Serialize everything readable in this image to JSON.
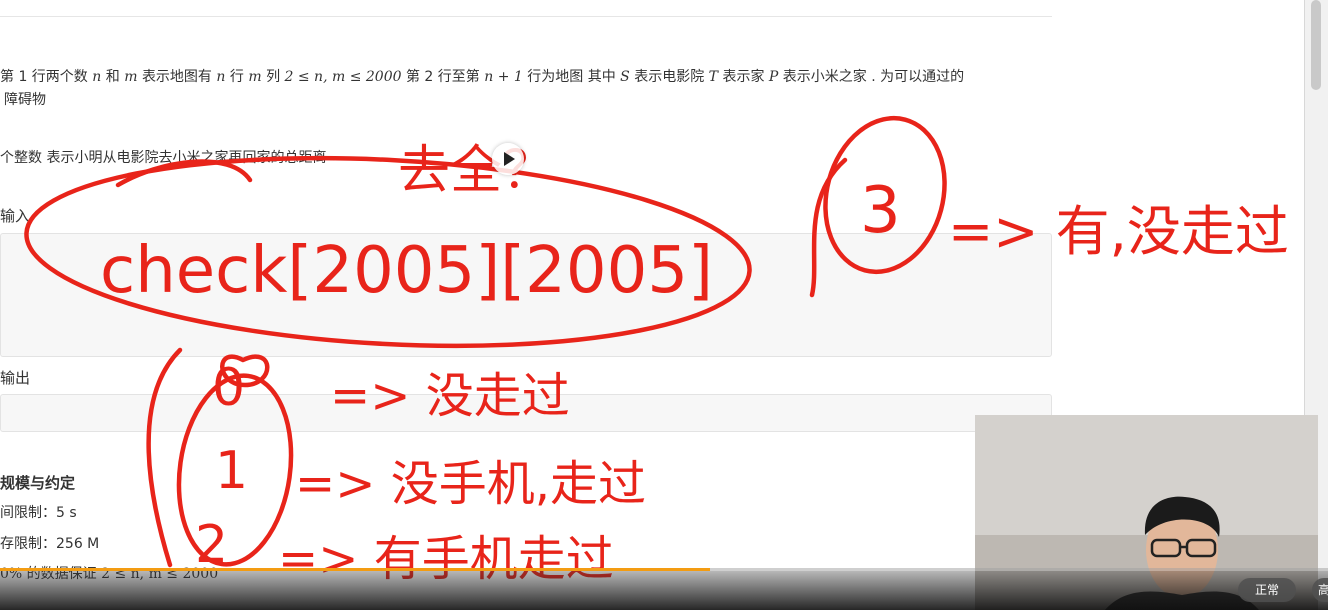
{
  "problem": {
    "input_line1_pre": "第 1 行两个数",
    "var_n": "n",
    "and": "和",
    "var_m": "m",
    "line1_b": "表示地图有",
    "line1_c": "行",
    "line1_d": "列",
    "constraint_math": "2 ≤ n, m ≤ 2000",
    "line1_e": "第 2 行至第",
    "n_plus_1": "n + 1",
    "line1_f": "行为地图 其中",
    "var_S": "S",
    "line1_g": "表示电影院",
    "var_T": "T",
    "line1_h": "表示家",
    "var_P": "P",
    "line1_i": "表示小米之家 . 为可以通过的",
    "input_line2": "障碍物",
    "output_desc": "个整数 表示小明从电影院去小米之家再回家的总距离",
    "sample_input_heading": "输入",
    "sample_output_heading": "输出",
    "limits_heading": "规模与约定",
    "time_limit": "间限制：5 s",
    "memory_limit": "存限制：256 M",
    "data_guarantee": "0% 的数据保证 2 ≤ n, m ≤ 2000"
  },
  "annotations": {
    "top_question": "去全？",
    "check_array": "check[2005][2005]",
    "state_3": "3",
    "state_3_desc": "=> 有,没走过",
    "state_0": "0",
    "state_0_desc": "=> 没走过",
    "state_1": "1",
    "state_1_desc": "=> 没手机,走过",
    "state_2": "2",
    "state_2_desc": "=> 有手机走过",
    "color": "#e8241a"
  },
  "player": {
    "progress_fraction": 0.535,
    "progress_color": "#f39c12",
    "speed_label": "正常",
    "extra_label": "高"
  }
}
